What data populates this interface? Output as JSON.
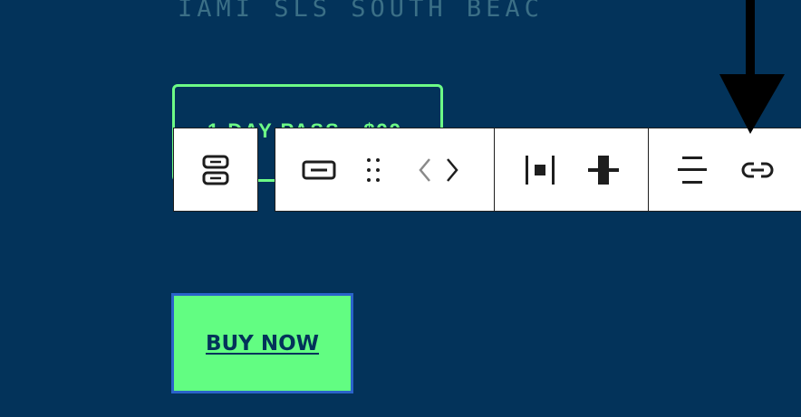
{
  "canvas": {
    "heading_text": "IAMI     SLS SOUTH BEAC",
    "outline_button_text": "1 DAY PASS - $99"
  },
  "toolbar": {
    "items": [
      {
        "icon": "buttons-block-icon",
        "label": "Buttons"
      },
      {
        "icon": "button-block-icon",
        "label": "Button"
      },
      {
        "icon": "drag-handle-icon",
        "label": "Drag"
      },
      {
        "icon": "move-left-icon",
        "label": "Move left"
      },
      {
        "icon": "move-right-icon",
        "label": "Move right"
      },
      {
        "icon": "justify-center-icon",
        "label": "Justify"
      },
      {
        "icon": "vertical-align-icon",
        "label": "Vertical alignment"
      },
      {
        "icon": "align-icon",
        "label": "Align"
      },
      {
        "icon": "link-icon",
        "label": "Link"
      }
    ]
  },
  "buy_button": {
    "label": "BUY NOW"
  },
  "colors": {
    "background": "#03335a",
    "accent_green": "#62fd82",
    "selection_blue": "#2a63c9",
    "toolbar_border": "#1e1e1e"
  }
}
